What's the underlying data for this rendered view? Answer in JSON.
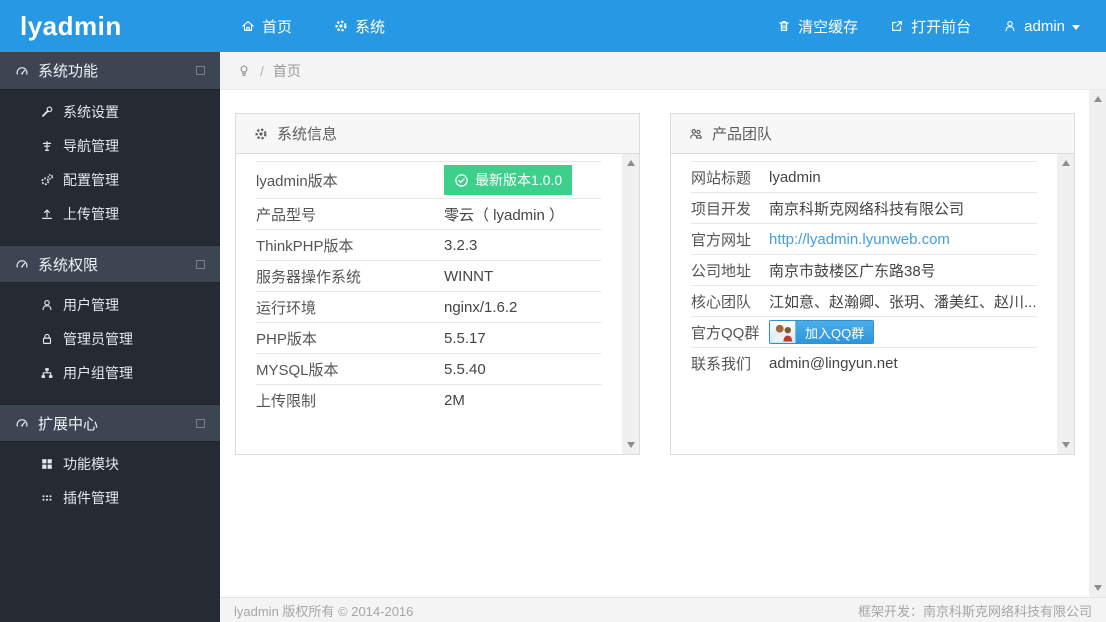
{
  "colors": {
    "topbar_blue": "#2798e3",
    "sidebar_dark": "#262b33",
    "sidebar_section": "#3d4553",
    "badge_green": "#3dd08b",
    "link_blue": "#3f9fdf",
    "qq_button_blue": "#2f95da"
  },
  "topbar": {
    "logo": "lyadmin",
    "nav": [
      {
        "label": "首页",
        "name": "nav-home",
        "icon": "home-icon"
      },
      {
        "label": "系统",
        "name": "nav-system",
        "icon": "gear-icon"
      }
    ],
    "actions": [
      {
        "label": "清空缓存",
        "name": "clear-cache-button",
        "icon": "trash-icon"
      },
      {
        "label": "打开前台",
        "name": "open-frontend-button",
        "icon": "external-link-icon"
      }
    ],
    "user": {
      "name": "admin",
      "icon": "user-icon"
    }
  },
  "sidebar": {
    "sections": [
      {
        "label": "系统功能",
        "name": "sidebar-section-system-functions",
        "icon": "gauge-icon",
        "items": [
          {
            "label": "系统设置",
            "name": "sidebar-item-system-settings",
            "icon": "wrench-icon"
          },
          {
            "label": "导航管理",
            "name": "sidebar-item-navigation-management",
            "icon": "signpost-icon"
          },
          {
            "label": "配置管理",
            "name": "sidebar-item-config-management",
            "icon": "gears-icon"
          },
          {
            "label": "上传管理",
            "name": "sidebar-item-upload-management",
            "icon": "upload-icon"
          }
        ]
      },
      {
        "label": "系统权限",
        "name": "sidebar-section-system-permissions",
        "icon": "gauge-icon",
        "items": [
          {
            "label": "用户管理",
            "name": "sidebar-item-user-management",
            "icon": "user-icon"
          },
          {
            "label": "管理员管理",
            "name": "sidebar-item-admin-management",
            "icon": "lock-icon"
          },
          {
            "label": "用户组管理",
            "name": "sidebar-item-user-group-management",
            "icon": "sitemap-icon"
          }
        ]
      },
      {
        "label": "扩展中心",
        "name": "sidebar-section-extension-center",
        "icon": "gauge-icon",
        "items": [
          {
            "label": "功能模块",
            "name": "sidebar-item-function-modules",
            "icon": "grid-icon"
          },
          {
            "label": "插件管理",
            "name": "sidebar-item-plugin-management",
            "icon": "dots-icon"
          }
        ]
      }
    ]
  },
  "breadcrumb": {
    "separator": "/",
    "current": "首页"
  },
  "panels": {
    "system_info": {
      "title": "系统信息",
      "icon": "gear-icon",
      "rows": [
        {
          "label": "lyadmin版本",
          "value": "最新版本1.0.0",
          "type": "badge"
        },
        {
          "label": "产品型号",
          "value": "零云（ lyadmin ）",
          "type": "text"
        },
        {
          "label": "ThinkPHP版本",
          "value": "3.2.3",
          "type": "text"
        },
        {
          "label": "服务器操作系统",
          "value": "WINNT",
          "type": "text"
        },
        {
          "label": "运行环境",
          "value": "nginx/1.6.2",
          "type": "text"
        },
        {
          "label": "PHP版本",
          "value": "5.5.17",
          "type": "text"
        },
        {
          "label": "MYSQL版本",
          "value": "5.5.40",
          "type": "text"
        },
        {
          "label": "上传限制",
          "value": "2M",
          "type": "text"
        }
      ]
    },
    "product_team": {
      "title": "产品团队",
      "icon": "team-icon",
      "rows": [
        {
          "label": "网站标题",
          "value": "lyadmin",
          "type": "text"
        },
        {
          "label": "项目开发",
          "value": "南京科斯克网络科技有限公司",
          "type": "text"
        },
        {
          "label": "官方网址",
          "value": "http://lyadmin.lyunweb.com",
          "type": "link"
        },
        {
          "label": "公司地址",
          "value": "南京市鼓楼区广东路38号",
          "type": "text"
        },
        {
          "label": "核心团队",
          "value": "江如意、赵瀚卿、张玥、潘美红、赵川...",
          "type": "text"
        },
        {
          "label": "官方QQ群",
          "value": "加入QQ群",
          "type": "qq"
        },
        {
          "label": "联系我们",
          "value": "admin@lingyun.net",
          "type": "text"
        }
      ]
    }
  },
  "footer": {
    "left": "lyadmin 版权所有 © 2014-2016",
    "right": "框架开发：南京科斯克网络科技有限公司"
  }
}
